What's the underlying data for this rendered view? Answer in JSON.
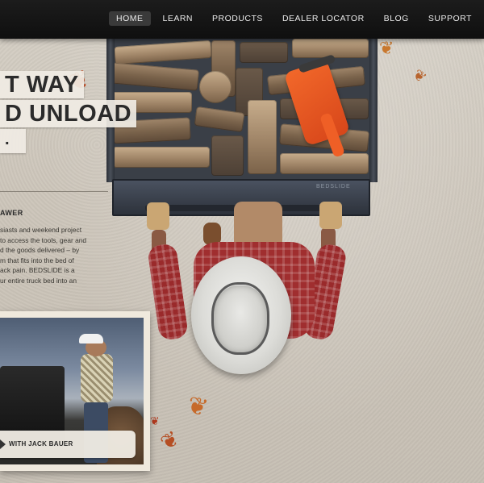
{
  "nav": {
    "items": [
      {
        "label": "HOME",
        "active": true
      },
      {
        "label": "LEARN",
        "active": false
      },
      {
        "label": "PRODUCTS",
        "active": false
      },
      {
        "label": "DEALER LOCATOR",
        "active": false
      },
      {
        "label": "BLOG",
        "active": false
      },
      {
        "label": "SUPPORT",
        "active": false
      }
    ]
  },
  "hero": {
    "headline_line1": "T WAY",
    "headline_line2": "D UNLOAD",
    "headline_line3": ".",
    "subhead": "AWER",
    "body_lines": [
      "siasts and weekend project",
      "to access the tools, gear and",
      "d the goods delivered – by",
      "m that fits into the bed of",
      "ack pain. BEDSLIDE is a",
      "ur entire truck bed into an"
    ]
  },
  "product": {
    "brand_mark": "BEDSLIDE"
  },
  "video_card": {
    "caption": "WITH JACK BAUER"
  },
  "colors": {
    "nav_bg": "#121212",
    "nav_active_bg": "#3a3a3a",
    "chainsaw": "#e8541f",
    "shirt": "#a02e2f",
    "ground": "#cfc8bd"
  }
}
